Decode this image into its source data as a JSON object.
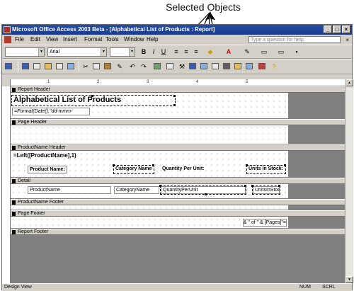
{
  "callout": {
    "text": "Selected Objects"
  },
  "window": {
    "title": "Microsoft Office Access 2003 Beta - [Alphabetical List of Products : Report]",
    "help_placeholder": "Type a question for help"
  },
  "menu": [
    "File",
    "Edit",
    "View",
    "Insert",
    "Format",
    "Tools",
    "Window",
    "Help"
  ],
  "toolbar": {
    "font": "Arial",
    "bold": "B",
    "italic": "I",
    "underline": "U"
  },
  "ruler": [
    "1",
    "2",
    "3",
    "4",
    "5"
  ],
  "sections": {
    "report_header": "Report Header",
    "page_header": "Page Header",
    "group_header": "ProductName Header",
    "detail": "Detail",
    "group_footer": "ProductName Footer",
    "page_footer": "Page Footer",
    "report_footer": "Report Footer"
  },
  "controls": {
    "report_title": "Alphabetical List of Products",
    "date_expr": "=Format(Date(),\"dd-mmm-",
    "group_expr": "=Left([ProductName],1)",
    "lbl_product": "Product Name:",
    "lbl_category": "Category Name",
    "lbl_quantity": "Quantity Per Unit:",
    "lbl_units": "Units In Stock:",
    "txt_product": "ProductName",
    "txt_category": "CategoryName",
    "txt_quantity": "QuantityPerUnit",
    "txt_units": "UnitsInStock",
    "page_expr": "=\"Page \" & [Page] & \" of \" & [Pages]"
  },
  "status": {
    "mode": "Design View",
    "num": "NUM",
    "scrl": "SCRL"
  }
}
